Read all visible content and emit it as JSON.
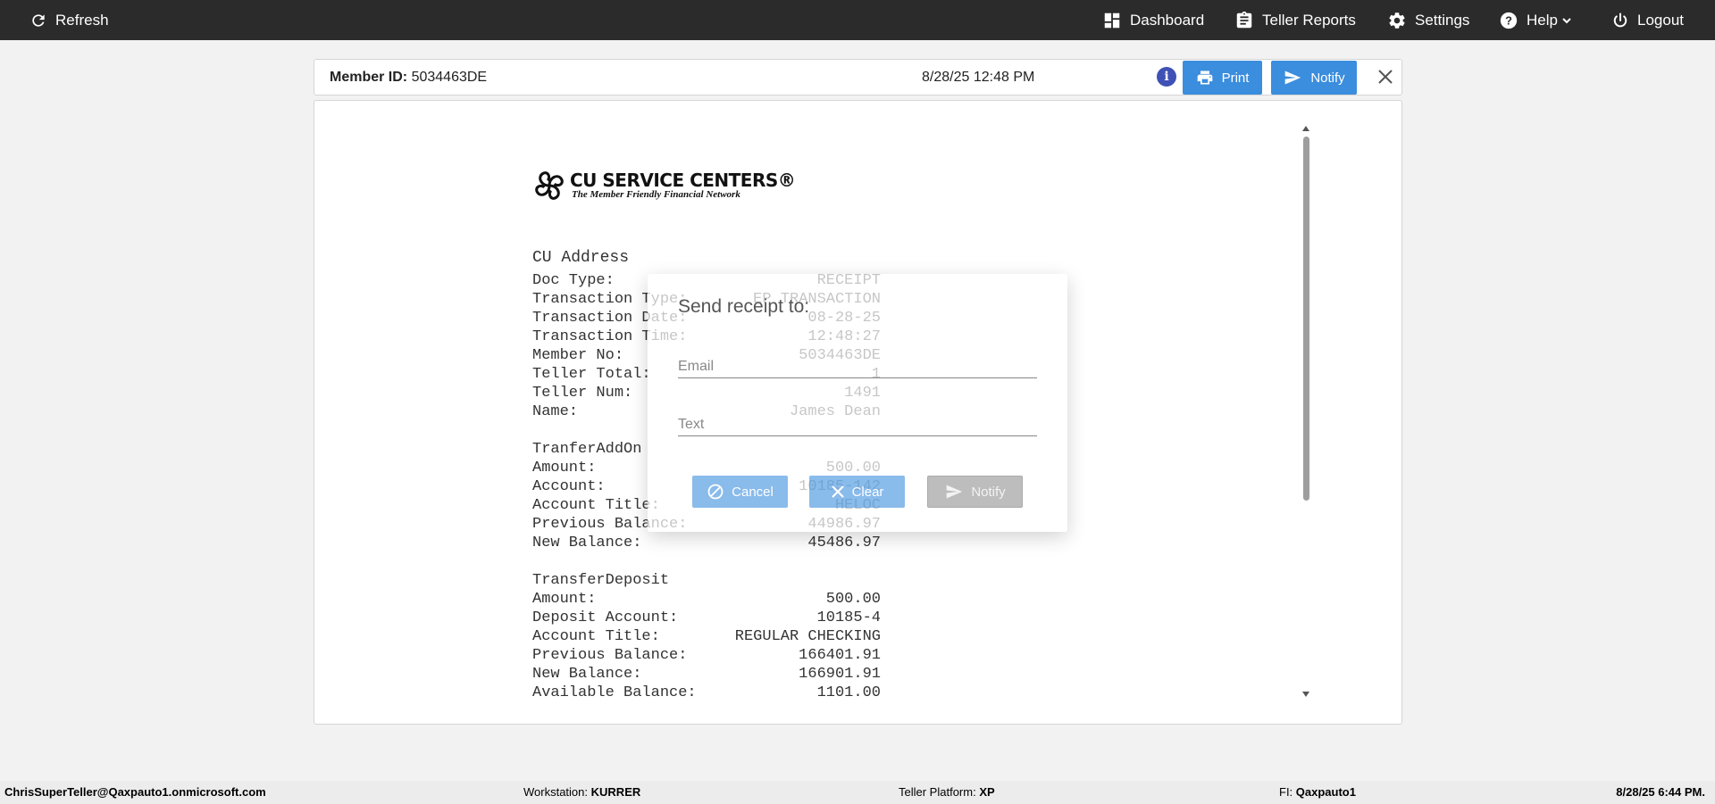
{
  "topbar": {
    "refresh": "Refresh",
    "dashboard": "Dashboard",
    "teller_reports": "Teller Reports",
    "settings": "Settings",
    "help": "Help",
    "logout": "Logout"
  },
  "receipt_header": {
    "member_id_label": "Member ID:",
    "member_id": "5034463DE",
    "datetime": "8/28/25 12:48 PM",
    "print": "Print",
    "notify": "Notify"
  },
  "logo": {
    "title": "CU SERVICE CENTERS®",
    "subtitle": "The Member Friendly Financial Network"
  },
  "receipt": {
    "address": "CU Address",
    "lines": [
      {
        "label": "Doc Type:",
        "value": "RECEIPT"
      },
      {
        "label": "Transaction Type:",
        "value": "EP TRANSACTION"
      },
      {
        "label": "Transaction Date:",
        "value": "08-28-25"
      },
      {
        "label": "Transaction Time:",
        "value": "12:48:27"
      },
      {
        "label": "Member No:",
        "value": "5034463DE"
      },
      {
        "label": "Teller Total:",
        "value": "1"
      },
      {
        "label": "Teller Num:",
        "value": "1491"
      },
      {
        "label": "Name:",
        "value": "James Dean"
      }
    ],
    "section1_title": "TranferAddOn",
    "section1": [
      {
        "label": "Amount:",
        "value": "500.00"
      },
      {
        "label": "Account:",
        "value": "10185-142"
      },
      {
        "label": "Account Title:",
        "value": "HELOC"
      },
      {
        "label": "Previous Balance:",
        "value": "44986.97"
      },
      {
        "label": "New Balance:",
        "value": "45486.97"
      }
    ],
    "section2_title": "TransferDeposit",
    "section2": [
      {
        "label": "Amount:",
        "value": "500.00"
      },
      {
        "label": "Deposit Account:",
        "value": "10185-4"
      },
      {
        "label": "Account Title:",
        "value": "REGULAR CHECKING"
      },
      {
        "label": "Previous Balance:",
        "value": "166401.91"
      },
      {
        "label": "New Balance:",
        "value": "166901.91"
      },
      {
        "label": "Available Balance:",
        "value": "1101.00"
      }
    ]
  },
  "modal": {
    "title": "Send receipt to:",
    "email_placeholder": "Email",
    "text_placeholder": "Text",
    "cancel": "Cancel",
    "clear": "Clear",
    "notify": "Notify"
  },
  "footer": {
    "user": "ChrisSuperTeller@Qaxpauto1.onmicrosoft.com",
    "workstation_label": "Workstation:",
    "workstation": "KURRER",
    "platform_label": "Teller Platform:",
    "platform": "XP",
    "fi_label": "FI:",
    "fi": "Qaxpauto1",
    "datetime": "8/28/25 6:44 PM."
  },
  "colors": {
    "topbar": "#2b2b2b",
    "primary_button": "#3b8ddd",
    "info_icon": "#3f51b5"
  }
}
